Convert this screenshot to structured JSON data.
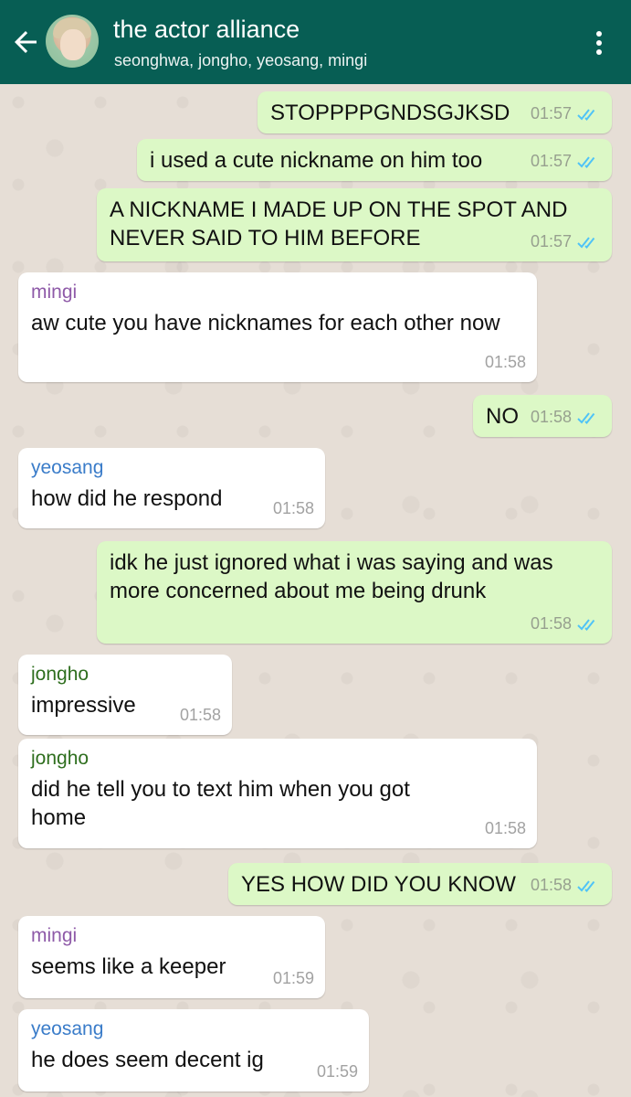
{
  "header": {
    "title": "the actor alliance",
    "subtitle": "seonghwa, jongho, yeosang, mingi"
  },
  "colors": {
    "header_bg": "#075e54",
    "outgoing_bubble": "#dcf8c6",
    "incoming_bubble": "#ffffff",
    "read_ticks": "#4fc3f7",
    "mingi_name": "#8e5aa8",
    "yeosang_name": "#3a7cc9",
    "jongho_name": "#2e6e1e"
  },
  "messages": [
    {
      "direction": "out",
      "text": "STOPPPPGNDSGJKSD",
      "time": "01:57",
      "ticks": "read"
    },
    {
      "direction": "out",
      "text": "i used a cute nickname on him too",
      "time": "01:57",
      "ticks": "read"
    },
    {
      "direction": "out",
      "text": "A NICKNAME I MADE UP ON THE SPOT AND NEVER SAID TO HIM BEFORE",
      "time": "01:57",
      "ticks": "read"
    },
    {
      "direction": "in",
      "sender": "mingi",
      "text": "aw cute you have nicknames for each other now",
      "time": "01:58"
    },
    {
      "direction": "out",
      "text": "NO",
      "time": "01:58",
      "ticks": "read"
    },
    {
      "direction": "in",
      "sender": "yeosang",
      "text": "how did he respond",
      "time": "01:58"
    },
    {
      "direction": "out",
      "text": "idk he just ignored what i was saying and was more concerned about me being drunk",
      "time": "01:58",
      "ticks": "read"
    },
    {
      "direction": "in",
      "sender": "jongho",
      "text": "impressive",
      "time": "01:58"
    },
    {
      "direction": "in",
      "sender": "jongho",
      "text": "did he tell you to text him when you got home",
      "time": "01:58"
    },
    {
      "direction": "out",
      "text": "YES HOW DID YOU KNOW",
      "time": "01:58",
      "ticks": "read"
    },
    {
      "direction": "in",
      "sender": "mingi",
      "text": "seems like a keeper",
      "time": "01:59"
    },
    {
      "direction": "in",
      "sender": "yeosang",
      "text": "he does seem decent ig",
      "time": "01:59"
    }
  ]
}
